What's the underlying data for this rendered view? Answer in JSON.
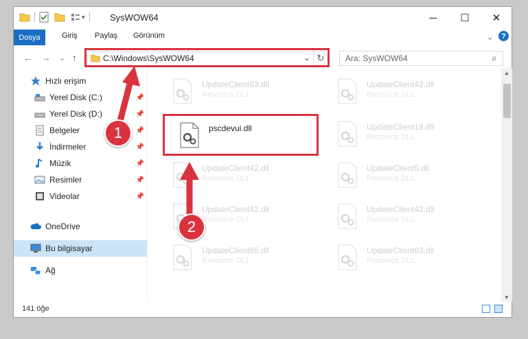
{
  "window": {
    "title": "SysWOW64",
    "minimize": "─",
    "maximize": "☐",
    "close": "✕"
  },
  "ribbon": {
    "tabs": [
      "Dosya",
      "Giriş",
      "Paylaş",
      "Görünüm"
    ],
    "expand": "⌄",
    "help": "?"
  },
  "address": {
    "path": "C:\\Windows\\SysWOW64",
    "refresh": "↻",
    "dropdown": "⌄"
  },
  "search": {
    "placeholder": "Ara: SysWOW64",
    "icon": "⌕"
  },
  "nav": {
    "back": "←",
    "forward": "→",
    "recent": "⌄",
    "up": "↑",
    "items": [
      {
        "label": "Hızlı erişim",
        "icon": "star-icon"
      },
      {
        "label": "Yerel Disk (C:)",
        "icon": "drive-icon"
      },
      {
        "label": "Yerel Disk (D:)",
        "icon": "drive-icon"
      },
      {
        "label": "Belgeler",
        "icon": "documents-icon"
      },
      {
        "label": "İndirmeler",
        "icon": "download-icon"
      },
      {
        "label": "Müzik",
        "icon": "music-icon"
      },
      {
        "label": "Resimler",
        "icon": "pictures-icon"
      },
      {
        "label": "Videolar",
        "icon": "videos-icon"
      },
      {
        "label": "OneDrive",
        "icon": "cloud-icon"
      },
      {
        "label": "Bu bilgisayar",
        "icon": "computer-icon"
      },
      {
        "label": "Ağ",
        "icon": "network-icon"
      }
    ]
  },
  "files": [
    {
      "name": "UpdateClient63.dll",
      "type": "Resource DLL"
    },
    {
      "name": "UpdateClient42.dll",
      "type": "Resource DLL"
    },
    {
      "name": "pscdevui.dll",
      "type": ""
    },
    {
      "name": "UpdateClient19.dll",
      "type": "Resource DLL"
    },
    {
      "name": "UpdateClient42.dll",
      "type": "Resource DLL"
    },
    {
      "name": "UpdateClient5.dll",
      "type": "Resource DLL"
    },
    {
      "name": "UpdateClient42.dll",
      "type": "Resource DLL"
    },
    {
      "name": "UpdateClient42.dll",
      "type": "Resource DLL"
    },
    {
      "name": "UpdateClient65.dll",
      "type": "Resource DLL"
    },
    {
      "name": "UpdateClient63.dll",
      "type": "Resource DLL"
    }
  ],
  "status": {
    "count": "141 öğe"
  },
  "annotations": {
    "step1": "1",
    "step2": "2"
  },
  "colors": {
    "accent": "#1a6fc4",
    "highlight": "#d9333f",
    "selected": "#cce4f7"
  }
}
